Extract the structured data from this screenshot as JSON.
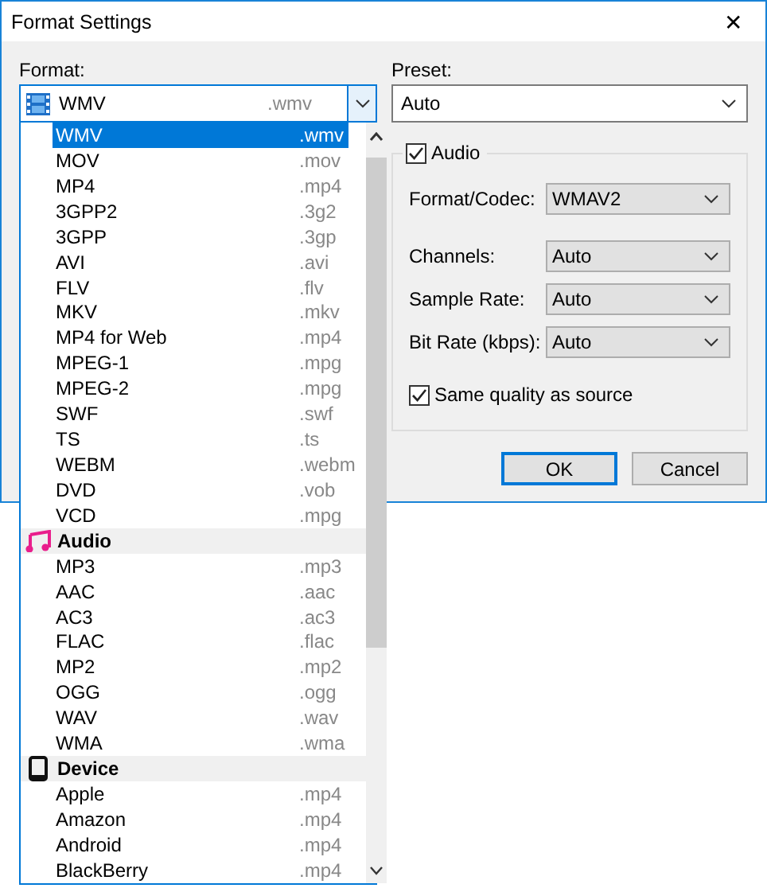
{
  "window": {
    "title": "Format Settings",
    "close": "✕"
  },
  "format": {
    "label": "Format:",
    "value": "WMV",
    "extension": ".wmv"
  },
  "format_list": [
    {
      "kind": "item",
      "name": "WMV",
      "extension": ".wmv",
      "selected": true
    },
    {
      "kind": "item",
      "name": "MOV",
      "extension": ".mov",
      "selected": false
    },
    {
      "kind": "item",
      "name": "MP4",
      "extension": ".mp4",
      "selected": false
    },
    {
      "kind": "item",
      "name": "3GPP2",
      "extension": ".3g2",
      "selected": false
    },
    {
      "kind": "item",
      "name": "3GPP",
      "extension": ".3gp",
      "selected": false
    },
    {
      "kind": "item",
      "name": "AVI",
      "extension": ".avi",
      "selected": false
    },
    {
      "kind": "item",
      "name": "FLV",
      "extension": ".flv",
      "selected": false
    },
    {
      "kind": "item",
      "name": "MKV",
      "extension": ".mkv",
      "selected": false
    },
    {
      "kind": "item",
      "name": "MP4 for Web",
      "extension": ".mp4",
      "selected": false
    },
    {
      "kind": "item",
      "name": "MPEG-1",
      "extension": ".mpg",
      "selected": false
    },
    {
      "kind": "item",
      "name": "MPEG-2",
      "extension": ".mpg",
      "selected": false
    },
    {
      "kind": "item",
      "name": "SWF",
      "extension": ".swf",
      "selected": false
    },
    {
      "kind": "item",
      "name": "TS",
      "extension": ".ts",
      "selected": false
    },
    {
      "kind": "item",
      "name": "WEBM",
      "extension": ".webm",
      "selected": false
    },
    {
      "kind": "item",
      "name": "DVD",
      "extension": ".vob",
      "selected": false
    },
    {
      "kind": "item",
      "name": "VCD",
      "extension": ".mpg",
      "selected": false
    },
    {
      "kind": "audio",
      "name": "Audio"
    },
    {
      "kind": "item",
      "name": "MP3",
      "extension": ".mp3",
      "selected": false
    },
    {
      "kind": "item",
      "name": "AAC",
      "extension": ".aac",
      "selected": false
    },
    {
      "kind": "item",
      "name": "AC3",
      "extension": ".ac3",
      "selected": false
    },
    {
      "kind": "item",
      "name": "FLAC",
      "extension": ".flac",
      "selected": false
    },
    {
      "kind": "item",
      "name": "MP2",
      "extension": ".mp2",
      "selected": false
    },
    {
      "kind": "item",
      "name": "OGG",
      "extension": ".ogg",
      "selected": false
    },
    {
      "kind": "item",
      "name": "WAV",
      "extension": ".wav",
      "selected": false
    },
    {
      "kind": "item",
      "name": "WMA",
      "extension": ".wma",
      "selected": false
    },
    {
      "kind": "device",
      "name": "Device"
    },
    {
      "kind": "item",
      "name": "Apple",
      "extension": ".mp4",
      "selected": false
    },
    {
      "kind": "item",
      "name": "Amazon",
      "extension": ".mp4",
      "selected": false
    },
    {
      "kind": "item",
      "name": "Android",
      "extension": ".mp4",
      "selected": false
    },
    {
      "kind": "item",
      "name": "BlackBerry",
      "extension": ".mp4",
      "selected": false
    }
  ],
  "preset": {
    "label": "Preset:",
    "value": "Auto"
  },
  "audio": {
    "label": "Audio",
    "checked": true,
    "fields": [
      {
        "label": "Format/Codec:",
        "value": "WMAV2"
      },
      {
        "label": "Channels:",
        "value": "Auto"
      },
      {
        "label": "Sample Rate:",
        "value": "Auto"
      },
      {
        "label": "Bit Rate (kbps):",
        "value": "Auto"
      }
    ],
    "same_quality": {
      "label": "Same quality as source",
      "checked": true
    }
  },
  "buttons": [
    {
      "label": "OK",
      "kind": "default"
    },
    {
      "label": "Cancel",
      "kind": "normal"
    }
  ]
}
